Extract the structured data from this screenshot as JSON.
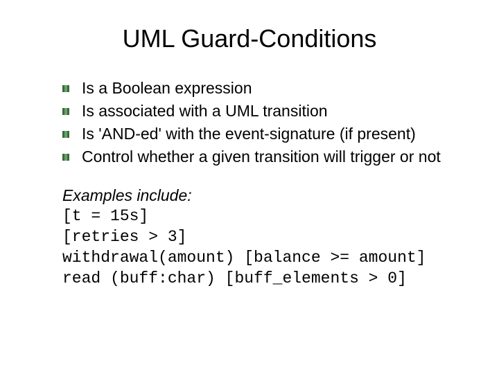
{
  "title": "UML Guard-Conditions",
  "bullets": [
    "Is a Boolean expression",
    "Is associated with a UML transition",
    "Is 'AND-ed' with the event-signature (if present)",
    "Control whether a given transition will trigger or not"
  ],
  "examples_heading": "Examples include:",
  "examples": [
    "[t = 15s]",
    "[retries > 3]",
    "withdrawal(amount) [balance >= amount]",
    "read (buff:char) [buff_elements > 0]"
  ]
}
